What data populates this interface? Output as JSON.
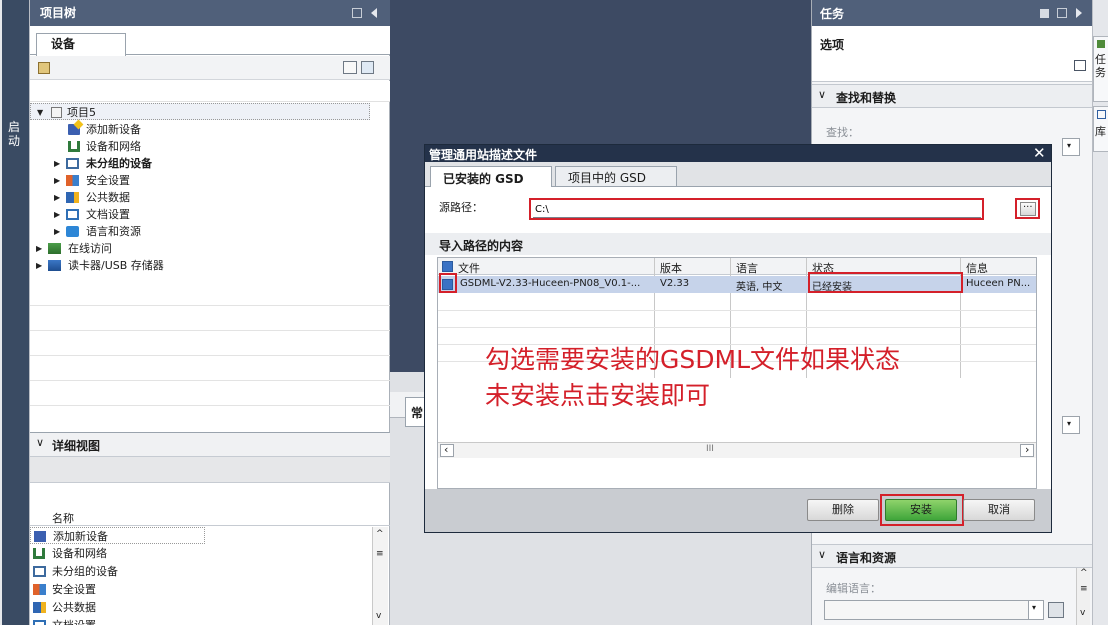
{
  "left_strip": {
    "label": "启动"
  },
  "project_tree": {
    "title": "项目树",
    "tab": "设备",
    "items": [
      {
        "label": "项目5",
        "icon": "project-icon",
        "expanded": true
      },
      {
        "label": "添加新设备",
        "icon": "add-device-icon"
      },
      {
        "label": "设备和网络",
        "icon": "network-icon"
      },
      {
        "label": "未分组的设备",
        "icon": "ungrouped-devices-icon",
        "bold": true
      },
      {
        "label": "安全设置",
        "icon": "security-icon"
      },
      {
        "label": "公共数据",
        "icon": "common-data-icon"
      },
      {
        "label": "文档设置",
        "icon": "document-settings-icon"
      },
      {
        "label": "语言和资源",
        "icon": "language-icon"
      },
      {
        "label": "在线访问",
        "icon": "online-access-icon"
      },
      {
        "label": "读卡器/USB 存储器",
        "icon": "card-reader-icon"
      }
    ]
  },
  "detail_view": {
    "title": "详细视图",
    "column": "名称",
    "items": [
      "添加新设备",
      "设备和网络",
      "未分组的设备",
      "安全设置",
      "公共数据",
      "文档设置"
    ]
  },
  "inspector_tab": {
    "label": "常"
  },
  "tasks": {
    "title": "任务",
    "options_label": "选项",
    "find_replace": {
      "title": "查找和替换",
      "find_label": "查找："
    },
    "language_resources": {
      "title": "语言和资源",
      "edit_language_label": "编辑语言："
    },
    "side_tabs": [
      "任务",
      "库"
    ]
  },
  "dialog": {
    "title": "管理通用站描述文件",
    "tabs": [
      "已安装的 GSD",
      "项目中的 GSD"
    ],
    "source_path_label": "源路径：",
    "source_path_value": "C:\\",
    "browse_label": "...",
    "section_title": "导入路径的内容",
    "columns": [
      "文件",
      "版本",
      "语言",
      "状态",
      "信息"
    ],
    "rows": [
      {
        "checked": true,
        "file": "GSDML-V2.33-Huceen-PN08_V0.1-...",
        "version": "V2.33",
        "language": "英语, 中文",
        "status": "已经安装",
        "info": "Huceen PN..."
      }
    ],
    "annotation": [
      "勾选需要安装的GSDML文件如果状态",
      "未安装点击安装即可"
    ],
    "scroll_mid": "III",
    "buttons": {
      "delete": "删除",
      "install": "安装",
      "cancel": "取消"
    },
    "annotation_color": "#d4202a"
  }
}
